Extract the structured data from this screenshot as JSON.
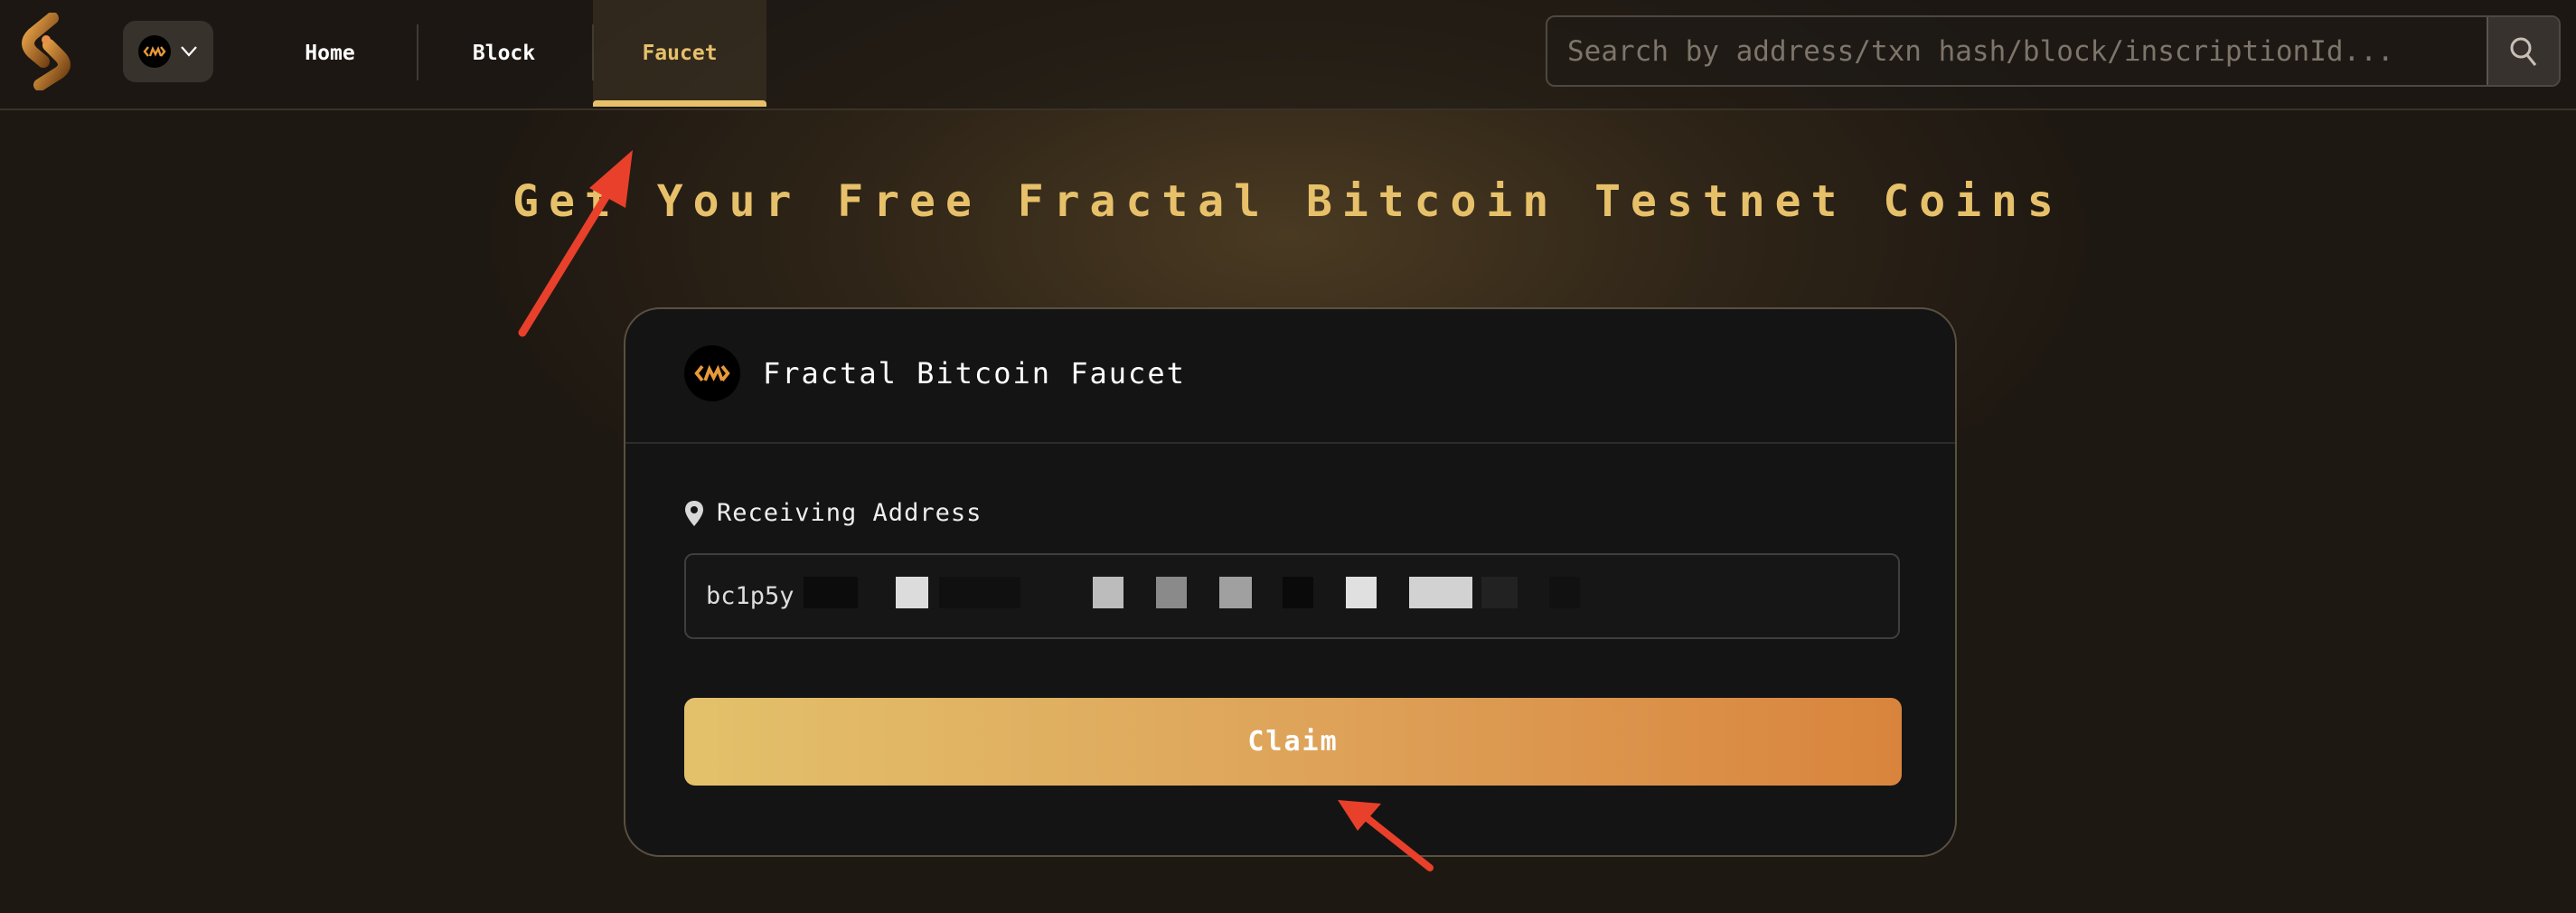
{
  "header": {
    "logo": "stripe-s-logo",
    "network_selector": {
      "icon": "fractal-bitcoin-icon",
      "chevron": "chevron-down-icon"
    },
    "nav": [
      {
        "label": "Home",
        "active": false
      },
      {
        "label": "Block",
        "active": false
      },
      {
        "label": "Faucet",
        "active": true
      }
    ],
    "search": {
      "placeholder": "Search by address/txn hash/block/inscriptionId...",
      "value": "",
      "button_icon": "search-icon"
    }
  },
  "main": {
    "title": "Get Your Free Fractal Bitcoin Testnet Coins",
    "card": {
      "title": "Fractal Bitcoin Faucet",
      "icon": "fractal-bitcoin-icon",
      "address_label": "Receiving Address",
      "address_label_icon": "location-pin-icon",
      "address_value": "bc1p5y",
      "address_redacted": true,
      "claim_label": "Claim"
    }
  },
  "annotations": [
    {
      "type": "arrow",
      "target": "Faucet tab",
      "color": "#e8402a"
    },
    {
      "type": "arrow",
      "target": "Claim button",
      "color": "#e8402a"
    }
  ],
  "colors": {
    "accent": "#e7c06a",
    "claim_gradient_start": "#e3c16b",
    "claim_gradient_end": "#d9843d",
    "annotation": "#e8402a"
  }
}
